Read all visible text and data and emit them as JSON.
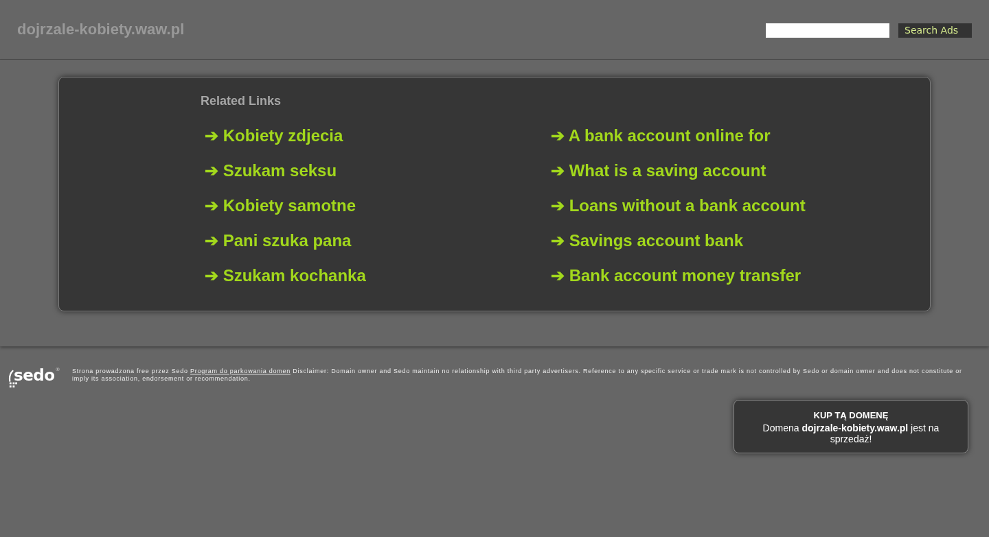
{
  "header": {
    "site_title": "dojrzale-kobiety.waw.pl",
    "search_button": "Search Ads"
  },
  "related_links": {
    "title": "Related Links",
    "columns": [
      {
        "links": [
          "➔ Kobiety zdjecia",
          "➔ Szukam seksu",
          "➔ Kobiety samotne",
          "➔ Pani szuka pana",
          "➔ Szukam kochanka"
        ]
      },
      {
        "links": [
          "➔ A bank account online for",
          "➔ What is a saving account",
          "➔ Loans without a bank account",
          "➔ Savings account bank",
          "➔ Bank account money transfer"
        ]
      }
    ]
  },
  "footer": {
    "logo": "sedo$^{®}$",
    "disclaimer_before": "Strona prowadzona free przez Sedo",
    "disclaimer_link": "Program do parkowania domen",
    "disclaimer_after": "Disclaimer: Domain owner and Sedo maintain no relationship with third party advertisers. Reference to any specific service or trade mark is not controlled by Sedo or domain owner and does not constitute or imply its association, endorsement or recommendation."
  },
  "buy_box": {
    "title": "KUP TĄ DOMENĘ",
    "text": "Domena **dojrzale-kobiety.waw.pl** jest na sprzedaż!"
  }
}
